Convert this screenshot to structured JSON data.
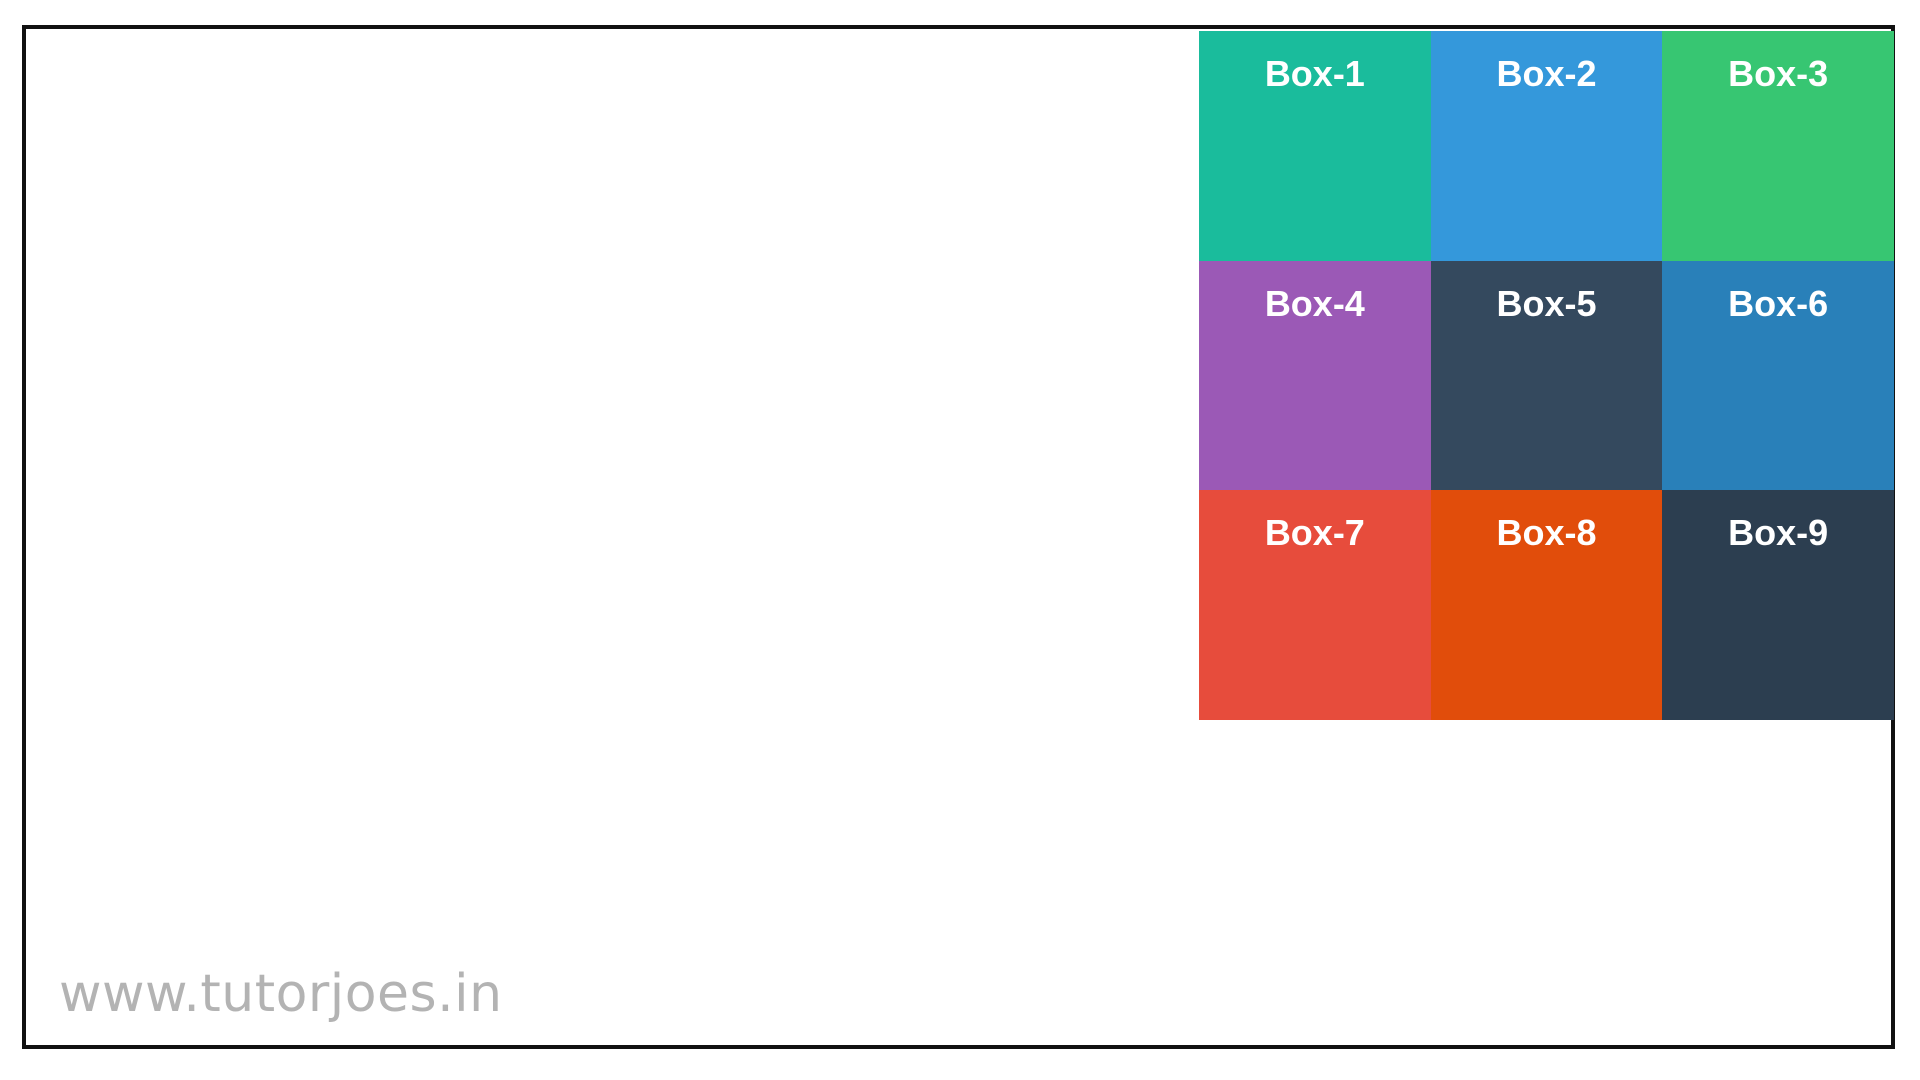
{
  "boxes": [
    {
      "label": "Box-1",
      "color": "#1abc9c"
    },
    {
      "label": "Box-2",
      "color": "#3498db"
    },
    {
      "label": "Box-3",
      "color": "#37c672"
    },
    {
      "label": "Box-4",
      "color": "#9b59b6"
    },
    {
      "label": "Box-5",
      "color": "#34495e"
    },
    {
      "label": "Box-6",
      "color": "#2980b9"
    },
    {
      "label": "Box-7",
      "color": "#e74c3c"
    },
    {
      "label": "Box-8",
      "color": "#e14d0b"
    },
    {
      "label": "Box-9",
      "color": "#2c3e50"
    }
  ],
  "watermark": "www.tutorjoes.in",
  "colors": {
    "frame_border": "#111111",
    "watermark_text": "#b3b3b3",
    "box_text": "#ffffff"
  }
}
